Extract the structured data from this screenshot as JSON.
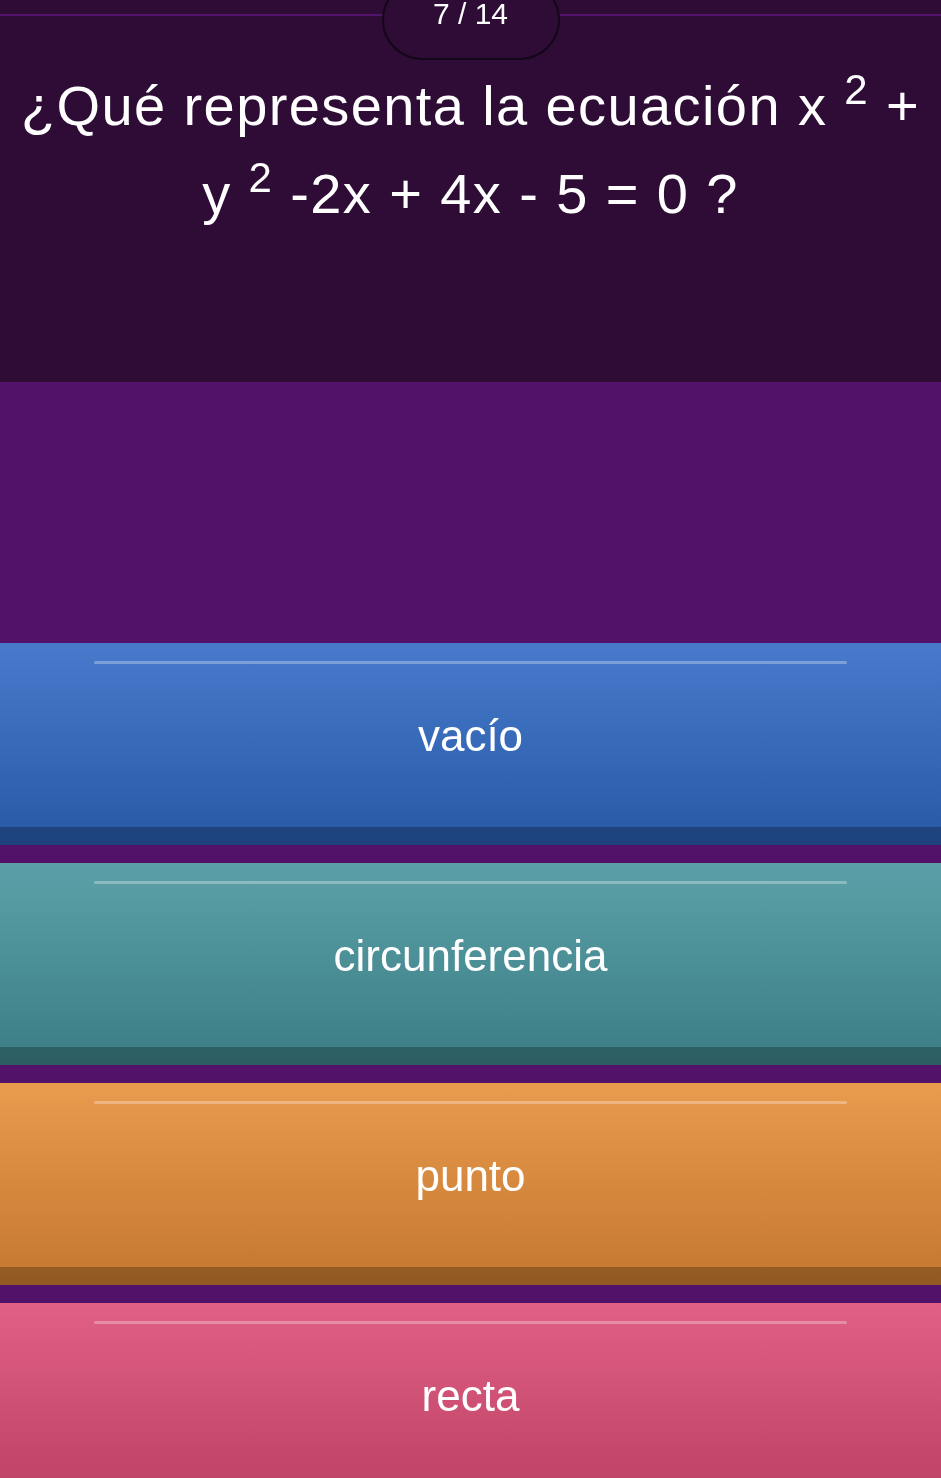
{
  "counter": "7 / 14",
  "question": "¿Qué representa la ecuación x $^{2}$ + y $^{2}$ -2x + 4x - 5 = 0 ?",
  "answers": [
    {
      "label": "vacío",
      "color": "#2e68c4"
    },
    {
      "label": "circunferencia",
      "color": "#45939c"
    },
    {
      "label": "punto",
      "color": "#e68d36"
    },
    {
      "label": "recta",
      "color": "#dc4b74"
    }
  ]
}
